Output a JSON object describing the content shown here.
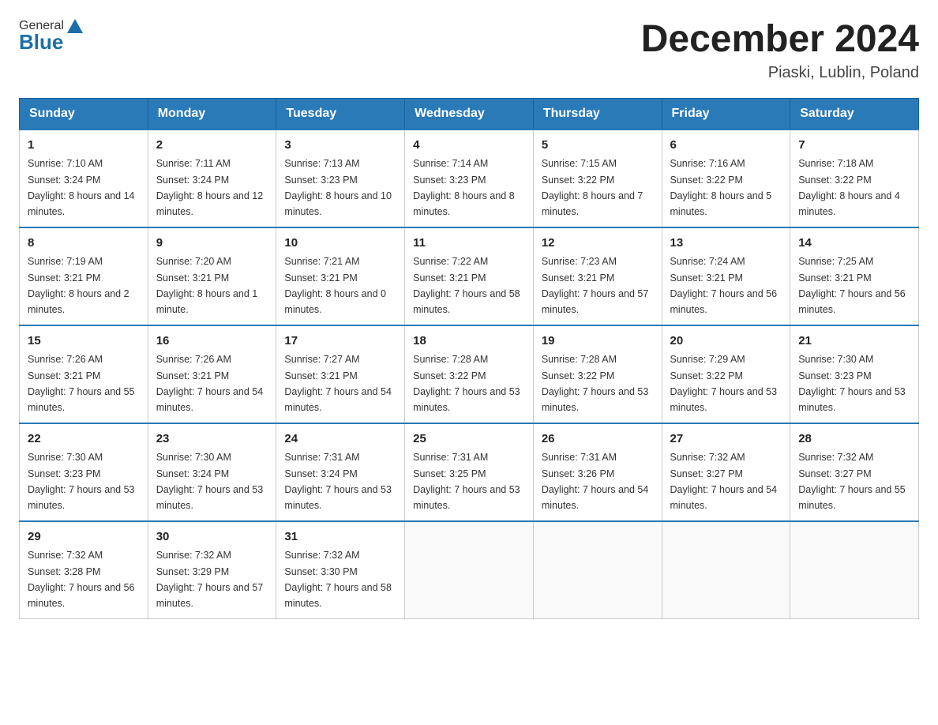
{
  "header": {
    "logo_general": "General",
    "logo_blue": "Blue",
    "month_title": "December 2024",
    "location": "Piaski, Lublin, Poland"
  },
  "weekdays": [
    "Sunday",
    "Monday",
    "Tuesday",
    "Wednesday",
    "Thursday",
    "Friday",
    "Saturday"
  ],
  "weeks": [
    [
      {
        "day": "1",
        "sunrise": "7:10 AM",
        "sunset": "3:24 PM",
        "daylight": "8 hours and 14 minutes."
      },
      {
        "day": "2",
        "sunrise": "7:11 AM",
        "sunset": "3:24 PM",
        "daylight": "8 hours and 12 minutes."
      },
      {
        "day": "3",
        "sunrise": "7:13 AM",
        "sunset": "3:23 PM",
        "daylight": "8 hours and 10 minutes."
      },
      {
        "day": "4",
        "sunrise": "7:14 AM",
        "sunset": "3:23 PM",
        "daylight": "8 hours and 8 minutes."
      },
      {
        "day": "5",
        "sunrise": "7:15 AM",
        "sunset": "3:22 PM",
        "daylight": "8 hours and 7 minutes."
      },
      {
        "day": "6",
        "sunrise": "7:16 AM",
        "sunset": "3:22 PM",
        "daylight": "8 hours and 5 minutes."
      },
      {
        "day": "7",
        "sunrise": "7:18 AM",
        "sunset": "3:22 PM",
        "daylight": "8 hours and 4 minutes."
      }
    ],
    [
      {
        "day": "8",
        "sunrise": "7:19 AM",
        "sunset": "3:21 PM",
        "daylight": "8 hours and 2 minutes."
      },
      {
        "day": "9",
        "sunrise": "7:20 AM",
        "sunset": "3:21 PM",
        "daylight": "8 hours and 1 minute."
      },
      {
        "day": "10",
        "sunrise": "7:21 AM",
        "sunset": "3:21 PM",
        "daylight": "8 hours and 0 minutes."
      },
      {
        "day": "11",
        "sunrise": "7:22 AM",
        "sunset": "3:21 PM",
        "daylight": "7 hours and 58 minutes."
      },
      {
        "day": "12",
        "sunrise": "7:23 AM",
        "sunset": "3:21 PM",
        "daylight": "7 hours and 57 minutes."
      },
      {
        "day": "13",
        "sunrise": "7:24 AM",
        "sunset": "3:21 PM",
        "daylight": "7 hours and 56 minutes."
      },
      {
        "day": "14",
        "sunrise": "7:25 AM",
        "sunset": "3:21 PM",
        "daylight": "7 hours and 56 minutes."
      }
    ],
    [
      {
        "day": "15",
        "sunrise": "7:26 AM",
        "sunset": "3:21 PM",
        "daylight": "7 hours and 55 minutes."
      },
      {
        "day": "16",
        "sunrise": "7:26 AM",
        "sunset": "3:21 PM",
        "daylight": "7 hours and 54 minutes."
      },
      {
        "day": "17",
        "sunrise": "7:27 AM",
        "sunset": "3:21 PM",
        "daylight": "7 hours and 54 minutes."
      },
      {
        "day": "18",
        "sunrise": "7:28 AM",
        "sunset": "3:22 PM",
        "daylight": "7 hours and 53 minutes."
      },
      {
        "day": "19",
        "sunrise": "7:28 AM",
        "sunset": "3:22 PM",
        "daylight": "7 hours and 53 minutes."
      },
      {
        "day": "20",
        "sunrise": "7:29 AM",
        "sunset": "3:22 PM",
        "daylight": "7 hours and 53 minutes."
      },
      {
        "day": "21",
        "sunrise": "7:30 AM",
        "sunset": "3:23 PM",
        "daylight": "7 hours and 53 minutes."
      }
    ],
    [
      {
        "day": "22",
        "sunrise": "7:30 AM",
        "sunset": "3:23 PM",
        "daylight": "7 hours and 53 minutes."
      },
      {
        "day": "23",
        "sunrise": "7:30 AM",
        "sunset": "3:24 PM",
        "daylight": "7 hours and 53 minutes."
      },
      {
        "day": "24",
        "sunrise": "7:31 AM",
        "sunset": "3:24 PM",
        "daylight": "7 hours and 53 minutes."
      },
      {
        "day": "25",
        "sunrise": "7:31 AM",
        "sunset": "3:25 PM",
        "daylight": "7 hours and 53 minutes."
      },
      {
        "day": "26",
        "sunrise": "7:31 AM",
        "sunset": "3:26 PM",
        "daylight": "7 hours and 54 minutes."
      },
      {
        "day": "27",
        "sunrise": "7:32 AM",
        "sunset": "3:27 PM",
        "daylight": "7 hours and 54 minutes."
      },
      {
        "day": "28",
        "sunrise": "7:32 AM",
        "sunset": "3:27 PM",
        "daylight": "7 hours and 55 minutes."
      }
    ],
    [
      {
        "day": "29",
        "sunrise": "7:32 AM",
        "sunset": "3:28 PM",
        "daylight": "7 hours and 56 minutes."
      },
      {
        "day": "30",
        "sunrise": "7:32 AM",
        "sunset": "3:29 PM",
        "daylight": "7 hours and 57 minutes."
      },
      {
        "day": "31",
        "sunrise": "7:32 AM",
        "sunset": "3:30 PM",
        "daylight": "7 hours and 58 minutes."
      },
      null,
      null,
      null,
      null
    ]
  ]
}
